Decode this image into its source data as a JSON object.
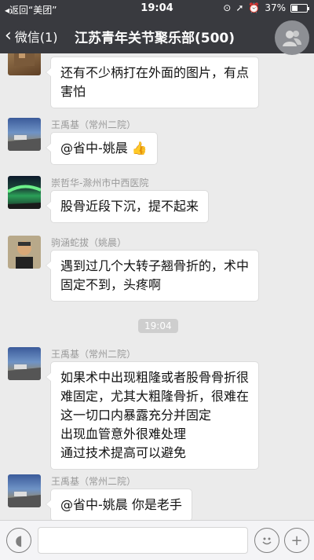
{
  "status_bar": {
    "back_label": "◂返回“美团”",
    "time": "19:04",
    "battery_percent": 37,
    "battery_label": "37%"
  },
  "nav": {
    "back_label": "微信(1)",
    "title": "江苏青年关节聚乐部(500)"
  },
  "messages": [
    {
      "sender": "",
      "lines": [
        "还有不少柄打在外面的图片，有点",
        "害怕"
      ],
      "avatar": "photo-avatar"
    },
    {
      "sender": "王禹基（常州二院）",
      "lines": [
        "@省中-姚晨 👍"
      ],
      "avatar": "road-avatar"
    },
    {
      "sender": "崇哲华-滁州市中西医院",
      "lines": [
        "股骨近段下沉，提不起来"
      ],
      "avatar": "aurora-avatar"
    },
    {
      "sender": "驹涵蛇拔（姚晨）",
      "lines": [
        "遇到过几个大转子翘骨折的，术中",
        "固定不到，头疼啊"
      ],
      "avatar": "person-avatar"
    },
    {
      "sender": "王禹基（常州二院）",
      "lines": [
        "如果术中出现粗隆或者股骨骨折很",
        "难固定，尤其大粗隆骨折，很难在",
        "这一切口内暴露充分并固定",
        "出现血管意外很难处理",
        "通过技术提高可以避免"
      ],
      "avatar": "road-avatar"
    },
    {
      "sender": "王禹基（常州二院）",
      "lines": [
        "@省中-姚晨 你是老手"
      ],
      "avatar": "road-avatar"
    }
  ],
  "timestamp": "19:04",
  "input": {
    "placeholder": ""
  },
  "colors": {
    "bar": "#393a3f",
    "chat_bg": "#ebebeb"
  }
}
